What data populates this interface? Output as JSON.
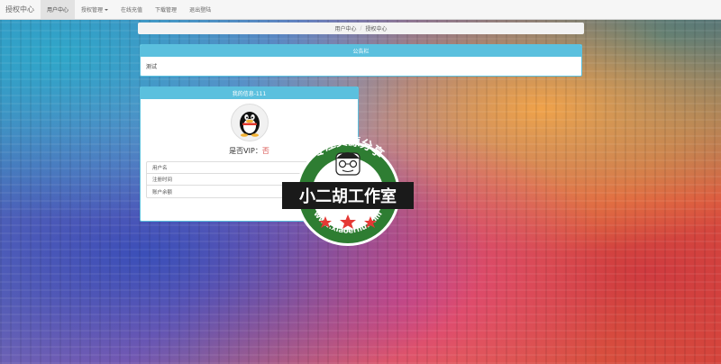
{
  "navbar": {
    "brand": "授权中心",
    "items": [
      {
        "label": "用户中心",
        "active": true
      },
      {
        "label": "授权管理",
        "dropdown": true
      },
      {
        "label": "在线充值"
      },
      {
        "label": "下载管理"
      },
      {
        "label": "退出登陆"
      }
    ]
  },
  "breadcrumb": [
    "用户中心",
    "授权中心"
  ],
  "notice_panel": {
    "title": "公告栏",
    "body": "测试"
  },
  "info_panel": {
    "title": "我的信息-111",
    "vip_label": "是否VIP：",
    "vip_value": "否",
    "rows": [
      {
        "label": "用户名",
        "value": "1"
      },
      {
        "label": "注册时间",
        "value": ""
      },
      {
        "label": "账户余额",
        "value": ""
      }
    ]
  },
  "watermark": {
    "top_text": "专注资源分享",
    "main_text": "小二胡工作室",
    "bottom_text": "www.xiaoerhu.com"
  }
}
